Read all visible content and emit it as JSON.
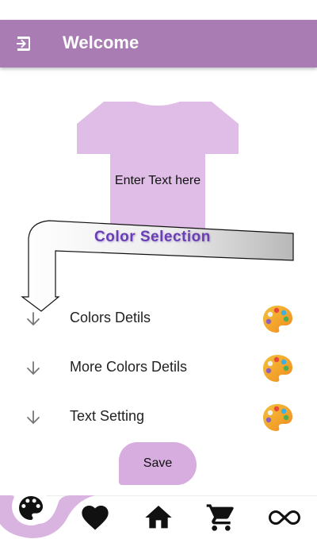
{
  "appbar": {
    "title": "Welcome",
    "icon": "login-icon",
    "color": "#a97db3"
  },
  "preview": {
    "shirt_text": "Enter Text here",
    "shirt_color": "#dfbde6"
  },
  "callout": {
    "label": "Color Selection"
  },
  "options": [
    {
      "label": "Colors Detils",
      "icon": "arrow-down-icon",
      "action_icon": "palette-icon"
    },
    {
      "label": "More Colors Detils",
      "icon": "arrow-down-icon",
      "action_icon": "palette-icon"
    },
    {
      "label": "Text Setting",
      "icon": "arrow-down-icon",
      "action_icon": "palette-icon"
    }
  ],
  "save": {
    "label": "Save",
    "color": "#d7acdf"
  },
  "nav": {
    "items": [
      {
        "icon": "palette-icon",
        "selected": true
      },
      {
        "icon": "heart-icon",
        "selected": false
      },
      {
        "icon": "home-icon",
        "selected": false
      },
      {
        "icon": "cart-icon",
        "selected": false
      },
      {
        "icon": "infinity-icon",
        "selected": false
      }
    ],
    "accent": "#d9b4e0"
  }
}
